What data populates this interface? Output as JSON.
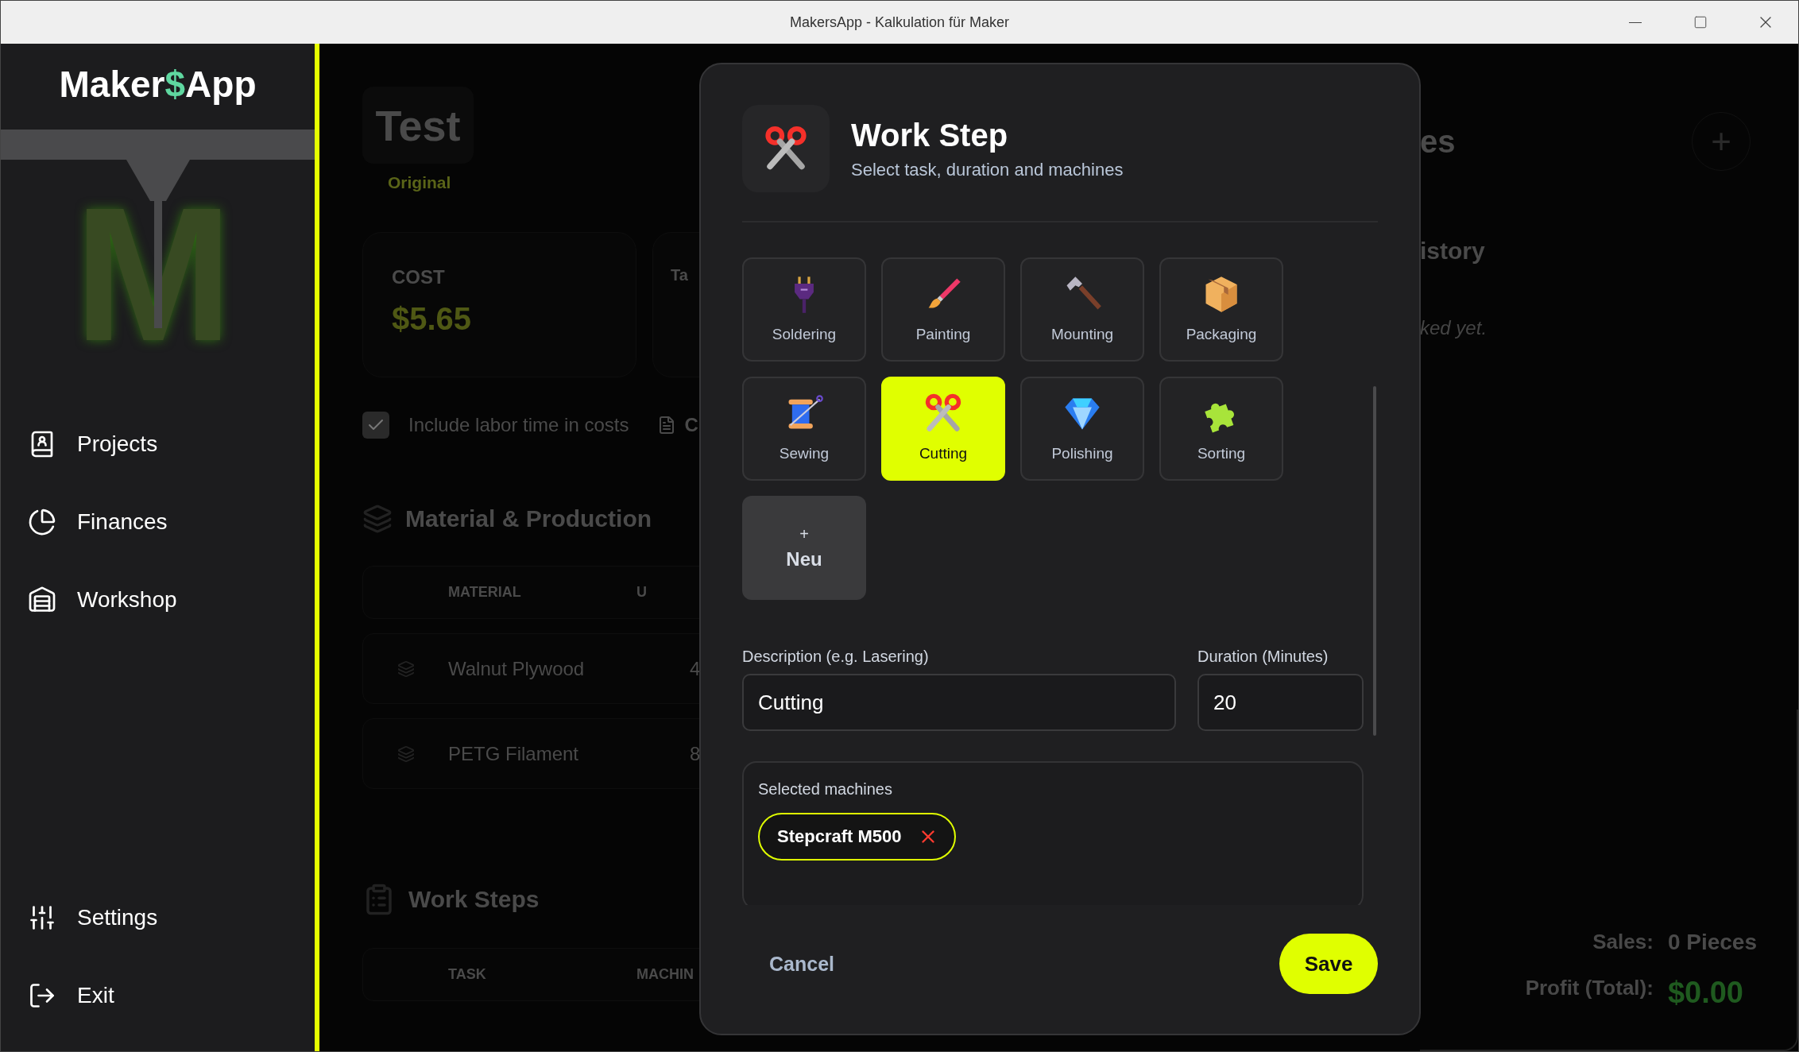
{
  "window": {
    "title": "MakersApp - Kalkulation für Maker"
  },
  "sidebar": {
    "logo": {
      "left": "Maker",
      "mark": "$",
      "right": "App"
    },
    "emblem_letter": "M",
    "nav": [
      {
        "label": "Projects",
        "kind": "book"
      },
      {
        "label": "Finances",
        "kind": "pie"
      },
      {
        "label": "Workshop",
        "kind": "garage"
      }
    ],
    "bottom_nav": [
      {
        "label": "Settings",
        "kind": "sliders"
      },
      {
        "label": "Exit",
        "kind": "exit"
      }
    ]
  },
  "background": {
    "project": {
      "title": "Test",
      "variant": "Original"
    },
    "cost_card": {
      "label": "COST",
      "value": "$5.65"
    },
    "second_card": {
      "label": "Ta"
    },
    "labor_checkbox": {
      "label": "Include labor time in costs",
      "checked": true
    },
    "export_link": "C",
    "materials": {
      "heading": "Material & Production",
      "columns": [
        "MATERIAL",
        "U"
      ],
      "rows": [
        {
          "name": "Walnut Plywood",
          "column_2": "4"
        },
        {
          "name": "PETG Filament",
          "column_2": "8"
        }
      ]
    },
    "work_steps": {
      "heading": "Work Steps",
      "columns": [
        "TASK",
        "MACHIN"
      ]
    },
    "right": {
      "heading": "es",
      "add": "+",
      "history_heading": "istory",
      "history_empty": "ked yet.",
      "sales_label": "Sales:",
      "sales_value": "0 Pieces",
      "profit_label": "Profit (Total):",
      "profit_value": "$0.00"
    }
  },
  "dialog": {
    "title": "Work Step",
    "subtitle": "Select task, duration and machines",
    "tasks": [
      {
        "label": "Soldering",
        "kind": "plug",
        "selected": false
      },
      {
        "label": "Painting",
        "kind": "brush",
        "selected": false
      },
      {
        "label": "Mounting",
        "kind": "hammer",
        "selected": false
      },
      {
        "label": "Packaging",
        "kind": "box",
        "selected": false
      },
      {
        "label": "Sewing",
        "kind": "spool",
        "selected": false
      },
      {
        "label": "Cutting",
        "kind": "scissors",
        "selected": true
      },
      {
        "label": "Polishing",
        "kind": "gem",
        "selected": false
      },
      {
        "label": "Sorting",
        "kind": "puzzle",
        "selected": false
      }
    ],
    "add_tile": {
      "icon": "+",
      "label": "Neu"
    },
    "description": {
      "label": "Description (e.g. Lasering)",
      "value": "Cutting"
    },
    "duration": {
      "label": "Duration (Minutes)",
      "value": "20"
    },
    "machines": {
      "label": "Selected machines",
      "chips": [
        {
          "name": "Stepcraft M500"
        }
      ]
    },
    "cancel": "Cancel",
    "save": "Save"
  }
}
